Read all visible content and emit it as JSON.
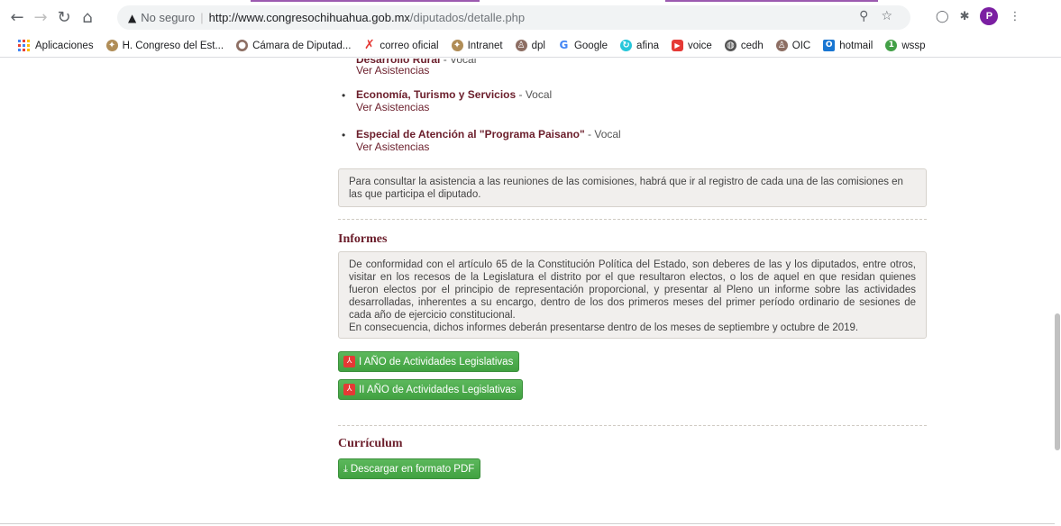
{
  "browser": {
    "security_label": "No seguro",
    "url_host": "http://www.congresochihuahua.gob.mx",
    "url_path": "/diputados/detalle.php",
    "avatar_initial": "P"
  },
  "bookmarks": [
    {
      "label": "Aplicaciones",
      "icon": "apps-icon",
      "color": "#4285f4"
    },
    {
      "label": "H. Congreso del Est...",
      "icon": "congress-icon",
      "color": "#b08d57"
    },
    {
      "label": "Cámara de Diputad...",
      "icon": "camara-icon",
      "color": "#8d6e63"
    },
    {
      "label": "correo oficial",
      "icon": "x-icon",
      "color": "#e53935"
    },
    {
      "label": "Intranet",
      "icon": "congress-icon",
      "color": "#b08d57"
    },
    {
      "label": "dpl",
      "icon": "person-icon",
      "color": "#8d6e63"
    },
    {
      "label": "Google",
      "icon": "google-icon",
      "color": "#4285f4"
    },
    {
      "label": "afina",
      "icon": "afina-icon",
      "color": "#26c6da"
    },
    {
      "label": "voice",
      "icon": "youtube-icon",
      "color": "#e53935"
    },
    {
      "label": "cedh",
      "icon": "globe-icon",
      "color": "#555555"
    },
    {
      "label": "OIC",
      "icon": "person-icon",
      "color": "#8d6e63"
    },
    {
      "label": "hotmail",
      "icon": "outlook-icon",
      "color": "#1976d2"
    },
    {
      "label": "wssp",
      "icon": "whatsapp-icon",
      "color": "#43a047"
    }
  ],
  "comisiones": {
    "partial_title": "Desarrollo Rural",
    "partial_role": " - Vocal",
    "items": [
      {
        "name": "Economía, Turismo y Servicios",
        "role": " - Vocal",
        "link": "Ver Asistencias"
      },
      {
        "name": "Especial de Atención al \"Programa Paisano\"",
        "role": " - Vocal",
        "link": "Ver Asistencias"
      }
    ],
    "top_link": "Ver Asistencias",
    "notice": "Para consultar la asistencia a las reuniones de las comisiones, habrá que ir al registro de cada una de las comisiones en las que participa el diputado."
  },
  "informes": {
    "title": "Informes",
    "body": "De conformidad con el artículo 65 de la Constitución Política del Estado, son deberes de las y los diputados, entre otros, visitar en los recesos de la Legislatura el distrito por el que resultaron electos, o los de aquel en que residan quienes fueron electos por el principio de representación proporcional, y presentar al Pleno un informe sobre las actividades desarrolladas, inherentes a su encargo, dentro de los dos primeros meses del primer período ordinario de sesiones de cada año de ejercicio constitucional.",
    "body2": "En consecuencia, dichos informes deberán presentarse dentro de los meses de septiembre y octubre de 2019.",
    "button1": "I AÑO de Actividades Legislativas",
    "button2": "II AÑO de Actividades Legislativas"
  },
  "curriculum": {
    "title": "Currículum",
    "button": "Descargar en formato PDF"
  }
}
